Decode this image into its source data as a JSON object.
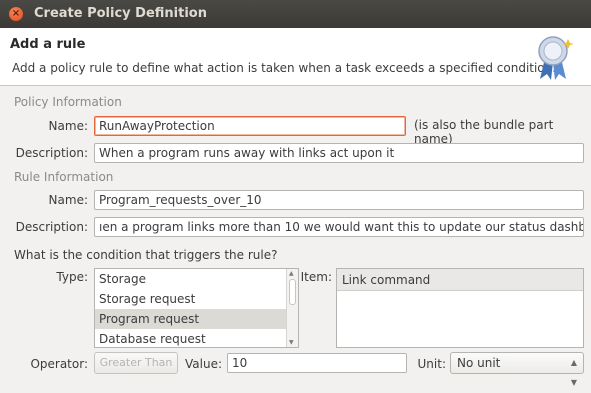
{
  "window": {
    "title": "Create Policy Definition",
    "close_glyph": "×"
  },
  "header": {
    "title": "Add a rule",
    "description": "Add a policy rule to define what action is taken when a task exceeds a specified condition.",
    "icon": "ribbon-badge-icon"
  },
  "policy_info": {
    "section_label": "Policy Information",
    "name_label": "Name:",
    "name_value": "RunAwayProtection",
    "name_hint": "(is also the bundle part name)",
    "description_label": "Description:",
    "description_value": "When a program runs away with links act upon it"
  },
  "rule_info": {
    "section_label": "Rule Information",
    "name_label": "Name:",
    "name_value": "Program_requests_over_10",
    "description_label": "Description:",
    "description_value": "ıen a program links more than 10 we would want this to update our status dashboard"
  },
  "condition": {
    "question": "What is the condition that triggers the rule?",
    "type_label": "Type:",
    "types": [
      "Storage",
      "Storage request",
      "Program request",
      "Database request"
    ],
    "selected_type": "Program request",
    "item_label": "Item:",
    "item_header": "Link command",
    "operator_label": "Operator:",
    "operator_button": "Greater Than",
    "value_label": "Value:",
    "value": "10",
    "unit_label": "Unit:",
    "unit_value": "No unit"
  },
  "colors": {
    "titlebar": "#3b3a36",
    "focus_border": "#e2673a",
    "close_button": "#df4a16"
  }
}
